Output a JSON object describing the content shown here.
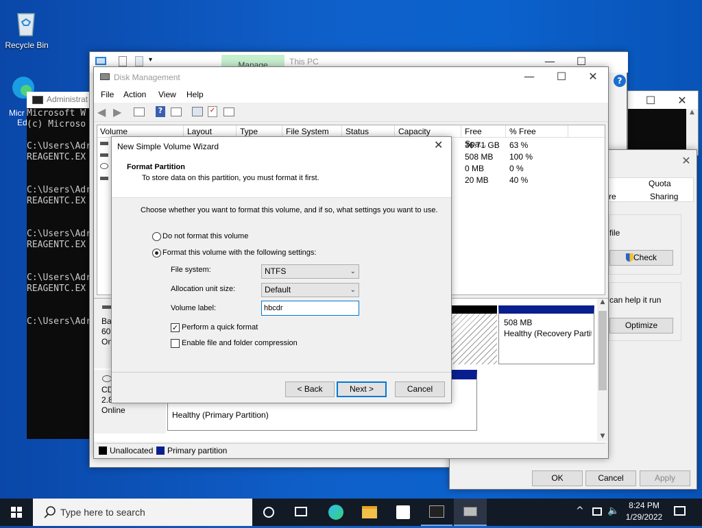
{
  "desktop": {
    "recycle_bin_label": "Recycle Bin",
    "edge_label_1": "Micr",
    "edge_label_2": "Ed"
  },
  "cmd": {
    "title": "Administrat",
    "lines": [
      "Microsoft W",
      "(c) Microso",
      "",
      "C:\\Users\\Adr",
      "REAGENTC.EX",
      "",
      "",
      "C:\\Users\\Adr",
      "REAGENTC.EX",
      "",
      "",
      "C:\\Users\\Adr",
      "REAGENTC.EX",
      "",
      "",
      "C:\\Users\\Adr",
      "REAGENTC.EX",
      "",
      "",
      "C:\\Users\\Adr"
    ]
  },
  "explorer": {
    "manage_tab": "Manage",
    "title": "This PC"
  },
  "props": {
    "tab_quota": "Quota",
    "tab_re": "re",
    "tab_sharing": "Sharing",
    "file_text": "file",
    "check_button": "Check",
    "help_text": "can help it run",
    "optimize_button": "Optimize",
    "ok_button": "OK",
    "cancel_button": "Cancel",
    "apply_button": "Apply"
  },
  "dm": {
    "title": "Disk Management",
    "menu": [
      "File",
      "Action",
      "View",
      "Help"
    ],
    "columns": [
      "Volume",
      "Layout",
      "Type",
      "File System",
      "Status",
      "Capacity",
      "Free Spa...",
      "% Free"
    ],
    "rows": [
      {
        "free": "36.71 GB",
        "pct": "63 %"
      },
      {
        "free": "508 MB",
        "pct": "100 %"
      },
      {
        "free": "0 MB",
        "pct": "0 %"
      },
      {
        "free": "20 MB",
        "pct": "40 %"
      }
    ],
    "disk0": {
      "label1": "Ba",
      "label2": "60.",
      "label3": "On"
    },
    "recovery": {
      "size": "508 MB",
      "status": "Healthy (Recovery Partit"
    },
    "cdrom": {
      "label1": "CD",
      "label2": "2.8",
      "label3": "Online"
    },
    "primary_status": "Healthy (Primary Partition)",
    "legend": {
      "unallocated": "Unallocated",
      "primary": "Primary partition"
    }
  },
  "wizard": {
    "title": "New Simple Volume Wizard",
    "heading": "Format Partition",
    "subheading": "To store data on this partition, you must format it first.",
    "instruction": "Choose whether you want to format this volume, and if so, what settings you want to use.",
    "radio_no_format": "Do not format this volume",
    "radio_format": "Format this volume with the following settings:",
    "fs_label": "File system:",
    "fs_value": "NTFS",
    "alloc_label": "Allocation unit size:",
    "alloc_value": "Default",
    "vol_label": "Volume label:",
    "vol_value": "hbcdr",
    "quick_format": "Perform a quick format",
    "compression": "Enable file and folder compression",
    "back_button": "< Back",
    "next_button": "Next >",
    "cancel_button": "Cancel"
  },
  "taskbar": {
    "search_placeholder": "Type here to search",
    "time": "8:24 PM",
    "date": "1/29/2022"
  }
}
